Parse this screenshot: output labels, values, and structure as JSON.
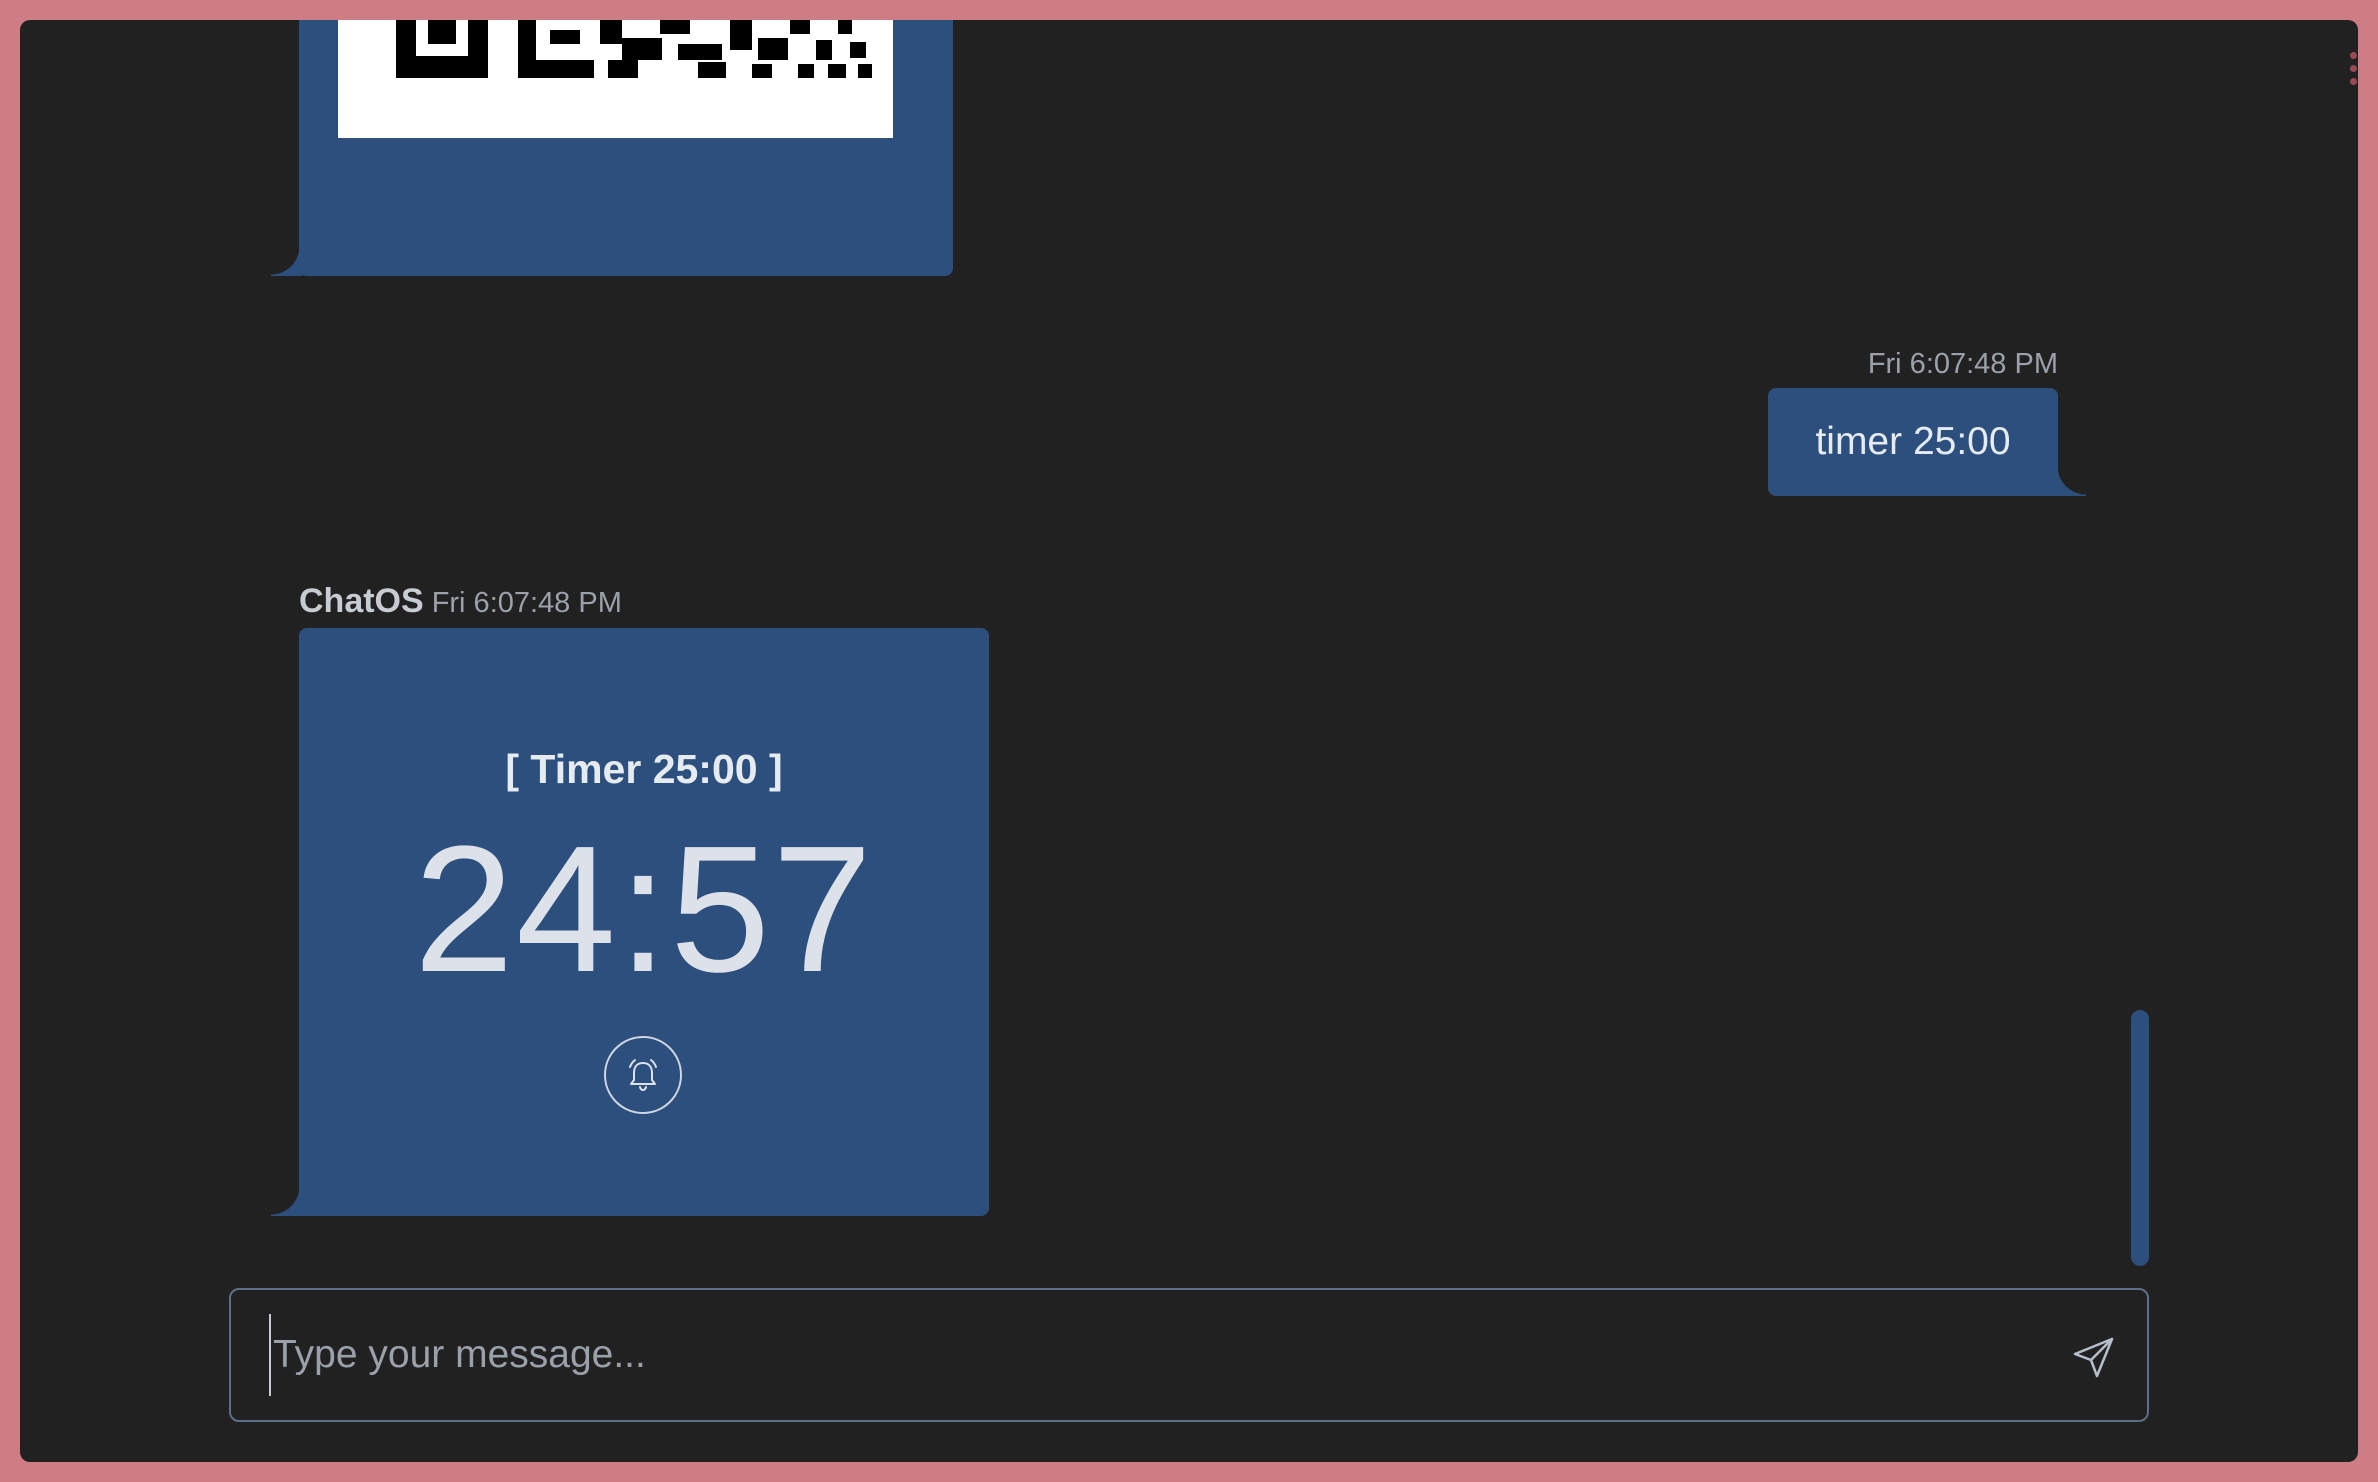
{
  "messages": {
    "qr": {
      "alt": "qr-code-image"
    },
    "user": {
      "timestamp": "Fri 6:07:48 PM",
      "text": "timer 25:00"
    },
    "bot": {
      "sender": "ChatOS",
      "timestamp": "Fri 6:07:48 PM",
      "timer_title": "[ Timer 25:00 ]",
      "timer_value": "24:57",
      "bell_icon": "bell-icon"
    }
  },
  "composer": {
    "placeholder": "Type your message...",
    "value": "",
    "send_icon": "send-icon"
  },
  "colors": {
    "frame": "#cf7d84",
    "background": "#212121",
    "bubble": "#2c4f7e",
    "muted_text": "#9aa1aa"
  }
}
